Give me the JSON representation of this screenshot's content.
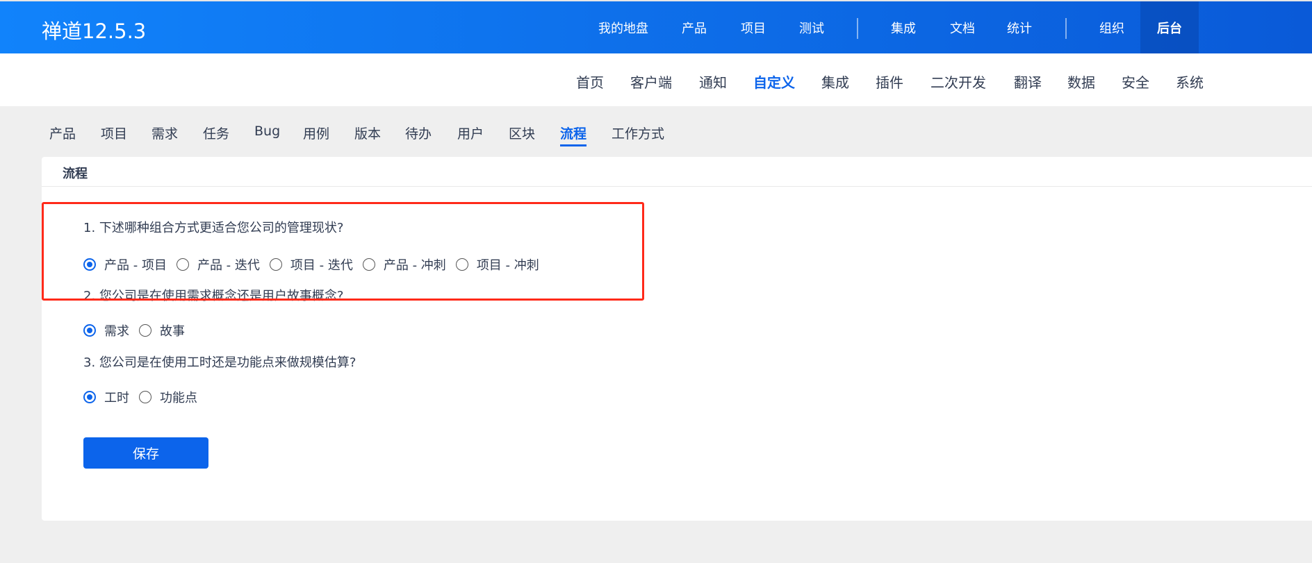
{
  "app": {
    "title": "禅道12.5.3"
  },
  "topnav": [
    "我的地盘",
    "产品",
    "项目",
    "测试",
    "集成",
    "文档",
    "统计",
    "组织",
    "后台"
  ],
  "topnav_active": "后台",
  "subnav": [
    "首页",
    "客户端",
    "通知",
    "自定义",
    "集成",
    "插件",
    "二次开发",
    "翻译",
    "数据",
    "安全",
    "系统"
  ],
  "subnav_active": "自定义",
  "tabs": [
    "产品",
    "项目",
    "需求",
    "任务",
    "Bug",
    "用例",
    "版本",
    "待办",
    "用户",
    "区块",
    "流程",
    "工作方式"
  ],
  "tabs_active": "流程",
  "panel": {
    "title": "流程",
    "questions": [
      {
        "text": "1. 下述哪种组合方式更适合您公司的管理现状?",
        "options": [
          "产品 - 项目",
          "产品 - 迭代",
          "项目 - 迭代",
          "产品 - 冲刺",
          "项目 - 冲刺"
        ],
        "selected": 0
      },
      {
        "text": "2. 您公司是在使用需求概念还是用户故事概念?",
        "options": [
          "需求",
          "故事"
        ],
        "selected": 0
      },
      {
        "text": "3. 您公司是在使用工时还是功能点来做规模估算?",
        "options": [
          "工时",
          "功能点"
        ],
        "selected": 0
      }
    ],
    "save_label": "保存"
  },
  "colors": {
    "accent": "#0c64eb",
    "highlight": "#ff2a1a"
  }
}
